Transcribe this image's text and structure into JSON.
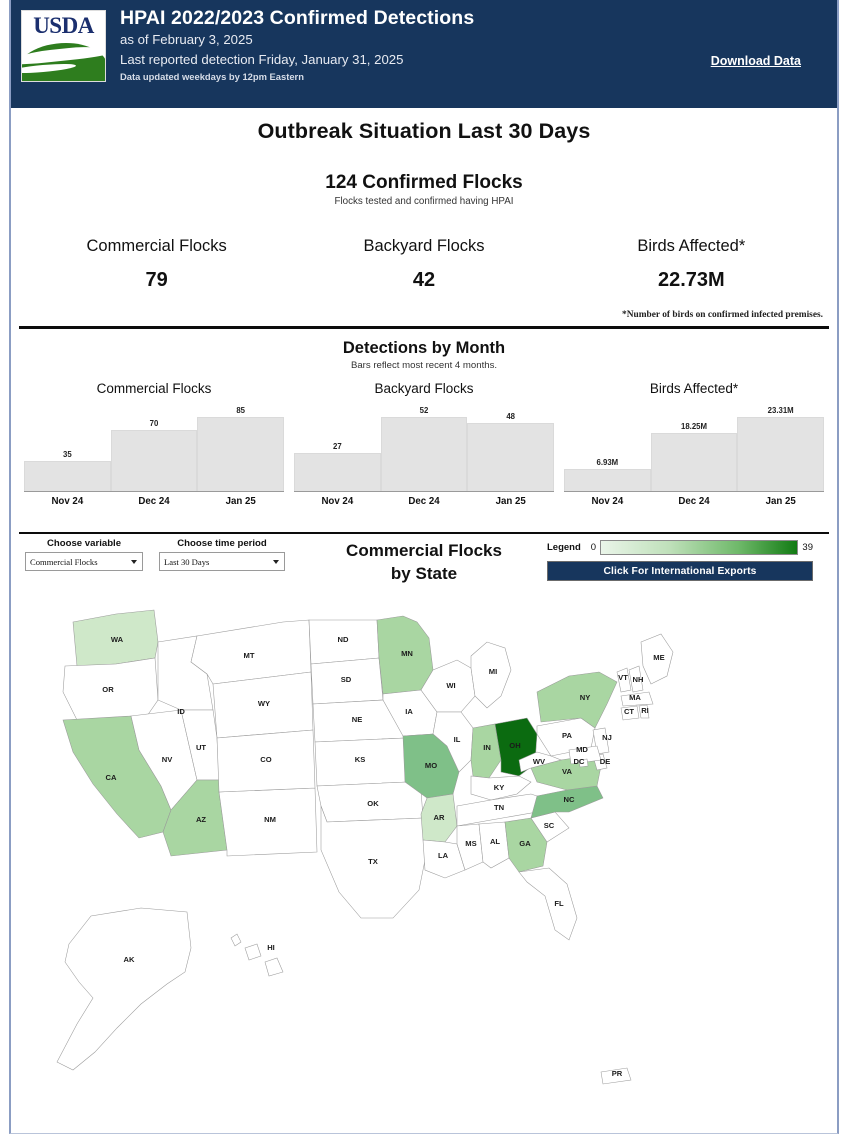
{
  "header": {
    "logo_text": "USDA",
    "title": "HPAI 2022/2023 Confirmed Detections",
    "as_of": "as of February 3, 2025",
    "last_reported": "Last reported detection Friday, January 31, 2025",
    "update_note": "Data updated weekdays by 12pm Eastern",
    "download_label": "Download Data",
    "bg_color": "#17365d"
  },
  "outbreak": {
    "section_title": "Outbreak Situation Last 30 Days",
    "confirmed_headline": "124 Confirmed Flocks",
    "confirmed_sub": "Flocks tested and confirmed having HPAI",
    "stats": [
      {
        "label": "Commercial Flocks",
        "value": "79"
      },
      {
        "label": "Backyard Flocks",
        "value": "42"
      },
      {
        "label": "Birds Affected*",
        "value": "22.73M"
      }
    ],
    "footnote": "*Number of birds on confirmed infected premises."
  },
  "detections": {
    "title": "Detections by Month",
    "subtitle": "Bars reflect most recent 4 months."
  },
  "chart_data": [
    {
      "type": "bar",
      "title": "Commercial Flocks",
      "categories": [
        "Nov 24",
        "Dec 24",
        "Jan 25"
      ],
      "values": [
        35,
        70,
        85
      ],
      "labels": [
        "35",
        "70",
        "85"
      ],
      "xlabel": "",
      "ylabel": "",
      "ylim": [
        0,
        100
      ],
      "grid": false,
      "legend": "none",
      "bar_color": "#e3e3e3"
    },
    {
      "type": "bar",
      "title": "Backyard Flocks",
      "categories": [
        "Nov 24",
        "Dec 24",
        "Jan 25"
      ],
      "values": [
        27,
        52,
        48
      ],
      "labels": [
        "27",
        "52",
        "48"
      ],
      "xlabel": "",
      "ylabel": "",
      "ylim": [
        0,
        60
      ],
      "grid": false,
      "legend": "none",
      "bar_color": "#e3e3e3"
    },
    {
      "type": "bar",
      "title": "Birds Affected*",
      "categories": [
        "Nov 24",
        "Dec 24",
        "Jan 25"
      ],
      "values": [
        6.93,
        18.25,
        23.31
      ],
      "labels": [
        "6.93M",
        "18.25M",
        "23.31M"
      ],
      "xlabel": "",
      "ylabel": "",
      "ylim": [
        0,
        27
      ],
      "grid": false,
      "legend": "none",
      "bar_color": "#e3e3e3"
    }
  ],
  "controls": {
    "variable_label": "Choose variable",
    "variable_value": "Commercial Flocks",
    "time_label": "Choose time period",
    "time_value": "Last 30 Days",
    "map_title_line1": "Commercial Flocks",
    "map_title_line2": "by State",
    "legend_label": "Legend",
    "legend_min": "0",
    "legend_max": "39",
    "exports_button": "Click For International Exports"
  },
  "map": {
    "colors": {
      "none": "#ffffff",
      "low": "#cfe8c9",
      "mid_low": "#a9d6a2",
      "mid": "#7fc088",
      "mid_high": "#5aa862",
      "high": "#0b6b10"
    },
    "states": [
      {
        "code": "WA",
        "fill": "low"
      },
      {
        "code": "OR",
        "fill": "none"
      },
      {
        "code": "CA",
        "fill": "mid_low"
      },
      {
        "code": "NV",
        "fill": "none"
      },
      {
        "code": "ID",
        "fill": "none"
      },
      {
        "code": "MT",
        "fill": "none"
      },
      {
        "code": "WY",
        "fill": "none"
      },
      {
        "code": "UT",
        "fill": "none"
      },
      {
        "code": "AZ",
        "fill": "mid_low"
      },
      {
        "code": "NM",
        "fill": "none"
      },
      {
        "code": "CO",
        "fill": "none"
      },
      {
        "code": "ND",
        "fill": "none"
      },
      {
        "code": "SD",
        "fill": "none"
      },
      {
        "code": "NE",
        "fill": "none"
      },
      {
        "code": "KS",
        "fill": "none"
      },
      {
        "code": "OK",
        "fill": "none"
      },
      {
        "code": "TX",
        "fill": "none"
      },
      {
        "code": "MN",
        "fill": "mid_low"
      },
      {
        "code": "IA",
        "fill": "none"
      },
      {
        "code": "MO",
        "fill": "mid"
      },
      {
        "code": "AR",
        "fill": "low"
      },
      {
        "code": "LA",
        "fill": "none"
      },
      {
        "code": "WI",
        "fill": "none"
      },
      {
        "code": "IL",
        "fill": "none"
      },
      {
        "code": "MI",
        "fill": "none"
      },
      {
        "code": "IN",
        "fill": "mid_low"
      },
      {
        "code": "OH",
        "fill": "high"
      },
      {
        "code": "KY",
        "fill": "none"
      },
      {
        "code": "TN",
        "fill": "none"
      },
      {
        "code": "MS",
        "fill": "none"
      },
      {
        "code": "AL",
        "fill": "none"
      },
      {
        "code": "GA",
        "fill": "mid_low"
      },
      {
        "code": "FL",
        "fill": "none"
      },
      {
        "code": "SC",
        "fill": "none"
      },
      {
        "code": "NC",
        "fill": "mid"
      },
      {
        "code": "VA",
        "fill": "mid_low"
      },
      {
        "code": "WV",
        "fill": "none"
      },
      {
        "code": "PA",
        "fill": "none"
      },
      {
        "code": "NY",
        "fill": "mid_low"
      },
      {
        "code": "VT",
        "fill": "none"
      },
      {
        "code": "NH",
        "fill": "none"
      },
      {
        "code": "ME",
        "fill": "none"
      },
      {
        "code": "MA",
        "fill": "none"
      },
      {
        "code": "CT",
        "fill": "none"
      },
      {
        "code": "RI",
        "fill": "none"
      },
      {
        "code": "NJ",
        "fill": "none"
      },
      {
        "code": "DE",
        "fill": "none"
      },
      {
        "code": "MD",
        "fill": "none"
      },
      {
        "code": "DC",
        "fill": "none"
      },
      {
        "code": "AK",
        "fill": "none"
      },
      {
        "code": "HI",
        "fill": "none"
      },
      {
        "code": "PR",
        "fill": "none"
      }
    ]
  }
}
